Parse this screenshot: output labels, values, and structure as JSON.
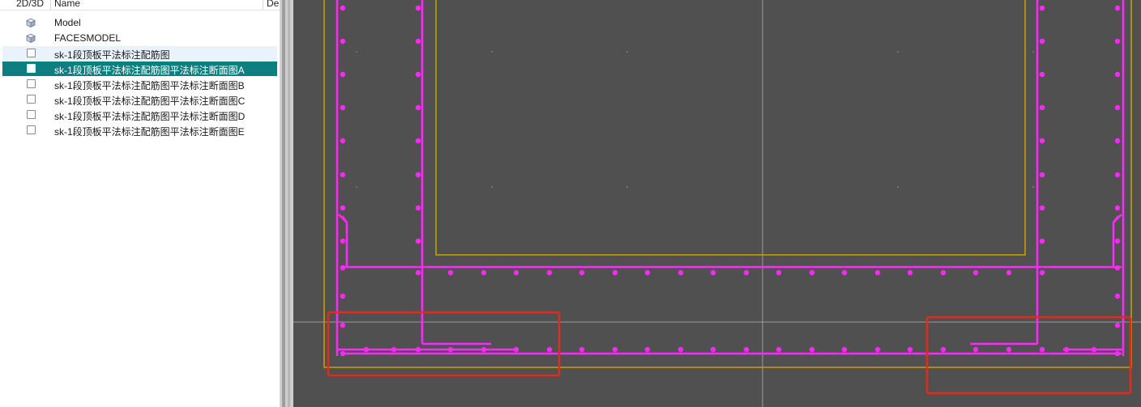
{
  "panel": {
    "columns": [
      {
        "label": "2D/3D"
      },
      {
        "label": "Name"
      },
      {
        "label": "De"
      }
    ],
    "items": [
      {
        "label": "Model",
        "icon": "model-cube-icon",
        "selected": false
      },
      {
        "label": "FACESMODEL",
        "icon": "model-cube-icon",
        "selected": false
      },
      {
        "label": "sk-1段顶板平法标注配筋图",
        "icon": "drawing-sheet-icon",
        "selected": false
      },
      {
        "label": "sk-1段顶板平法标注配筋图平法标注断面图A",
        "icon": "drawing-sheet-icon",
        "selected": true
      },
      {
        "label": "sk-1段顶板平法标注配筋图平法标注断面图B",
        "icon": "drawing-sheet-icon",
        "selected": false
      },
      {
        "label": "sk-1段顶板平法标注配筋图平法标注断面图C",
        "icon": "drawing-sheet-icon",
        "selected": false
      },
      {
        "label": "sk-1段顶板平法标注配筋图平法标注断面图D",
        "icon": "drawing-sheet-icon",
        "selected": false
      },
      {
        "label": "sk-1段顶板平法标注配筋图平法标注断面图E",
        "icon": "drawing-sheet-icon",
        "selected": false
      }
    ]
  },
  "viewport": {
    "colors": {
      "background": "#505050",
      "rebar": "#ff28ff",
      "outline": "#c9a400",
      "highlight": "#e42a1a",
      "crosshair": "#9a9a9a",
      "selection": "#0e7f80"
    }
  }
}
